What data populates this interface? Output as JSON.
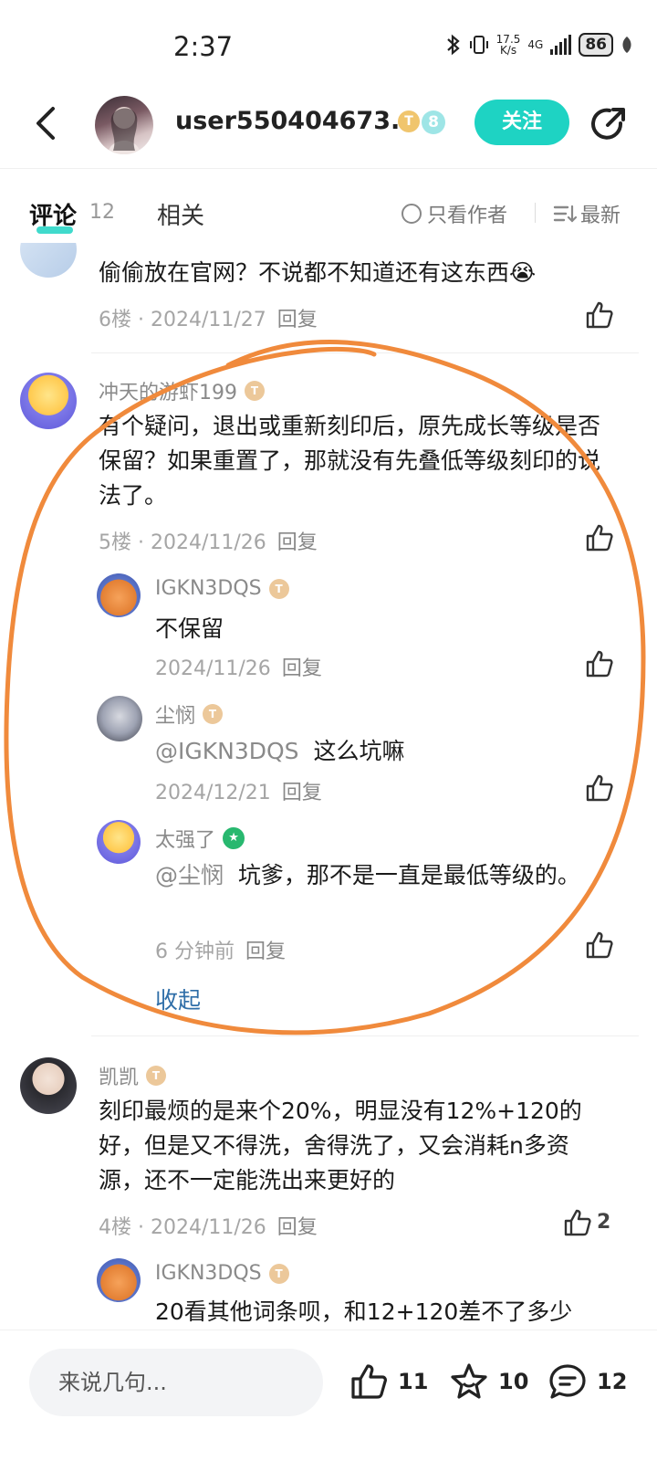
{
  "status_bar": {
    "time": "2:37",
    "net_speed_top": "17.5",
    "net_speed_bottom": "K/s",
    "net_type": "4G",
    "battery": "86"
  },
  "header": {
    "username": "user550404673...",
    "badge_t": "T",
    "level": "8",
    "follow_label": "关注"
  },
  "tabs": {
    "comments_label": "评论",
    "comments_count": "12",
    "related_label": "相关",
    "author_only_label": "只看作者",
    "sort_label": "最新"
  },
  "comments": [
    {
      "text": "偷偷放在官网？不说都不知道还有这东西😭",
      "floor": "6楼",
      "date": "2024/11/27",
      "reply_label": "回复"
    },
    {
      "user": "冲天的游虾199",
      "text": "有个疑问，退出或重新刻印后，原先成长等级是否保留？如果重置了，那就没有先叠低等级刻印的说法了。",
      "floor": "5楼",
      "date": "2024/11/26",
      "reply_label": "回复",
      "replies": [
        {
          "user": "IGKN3DQS",
          "text": "不保留",
          "date": "2024/11/26",
          "reply_label": "回复"
        },
        {
          "user": "尘悯",
          "mention": "@IGKN3DQS",
          "text": "这么坑嘛",
          "date": "2024/12/21",
          "reply_label": "回复"
        },
        {
          "user": "太强了",
          "mention": "@尘悯",
          "text": "坑爹，那不是一直是最低等级的。",
          "date": "6 分钟前",
          "reply_label": "回复"
        }
      ],
      "collapse_label": "收起"
    },
    {
      "user": "凯凯",
      "text": "刻印最烦的是来个20%，明显没有12%+120的好，但是又不得洗，舍得洗了，又会消耗n多资源，还不一定能洗出来更好的",
      "floor": "4楼",
      "date": "2024/11/26",
      "reply_label": "回复",
      "likes": "2",
      "replies": [
        {
          "user": "IGKN3DQS",
          "text": "20看其他词条呗，和12+120差不了多少"
        }
      ]
    }
  ],
  "bottom_bar": {
    "input_placeholder": "来说几句...",
    "likes": "11",
    "favorites": "10",
    "comments": "12"
  },
  "colors": {
    "accent": "#1ed3c3",
    "annotation": "#f08a3c",
    "link": "#2f6ea8"
  }
}
